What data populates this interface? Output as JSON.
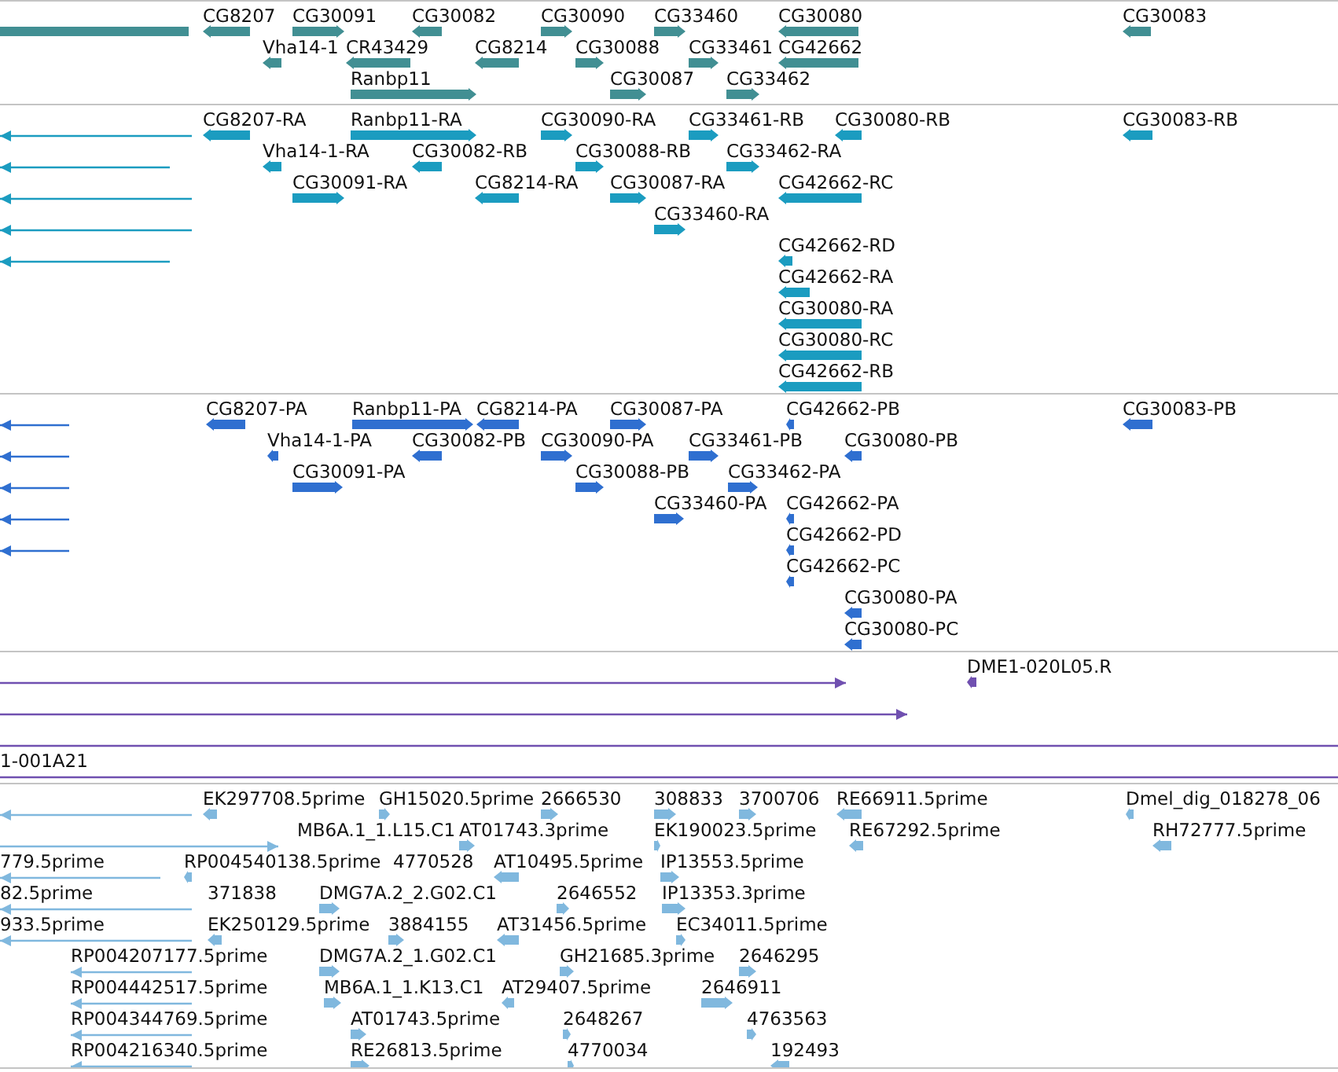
{
  "tracks": [
    {
      "kind": "gene",
      "color": "#418f93",
      "features": [
        {
          "kind": "cut"
        },
        {
          "label": "CG8207",
          "forward": false
        },
        {
          "label": "CG30091",
          "forward": true
        },
        {
          "label": "CG30082",
          "forward": false
        },
        {
          "label": "CG30090",
          "forward": true
        },
        {
          "label": "CG33460",
          "forward": true
        },
        {
          "label": "CG30080",
          "forward": false
        },
        {
          "label": "CG30083",
          "forward": false
        },
        {
          "label": "Vha14-1",
          "forward": false
        },
        {
          "label": "CR43429",
          "forward": false
        },
        {
          "label": "CG8214",
          "forward": false
        },
        {
          "label": "CG30088",
          "forward": true
        },
        {
          "label": "CG33461",
          "forward": true
        },
        {
          "label": "CG42662",
          "forward": false
        },
        {
          "label": "Ranbp11",
          "forward": true
        },
        {
          "label": "CG30087",
          "forward": true
        },
        {
          "label": "CG33462",
          "forward": true
        }
      ]
    },
    {
      "kind": "transcript",
      "color": "#1b9cc0",
      "features": [
        {
          "forward": false
        },
        {
          "label": "CG8207-RA",
          "forward": false
        },
        {
          "label": "Ranbp11-RA",
          "forward": true
        },
        {
          "label": "CG30090-RA",
          "forward": true
        },
        {
          "label": "CG33461-RB",
          "forward": true
        },
        {
          "label": "CG30080-RB",
          "forward": false
        },
        {
          "label": "CG30083-RB",
          "forward": false
        },
        {
          "forward": false
        },
        {
          "label": "Vha14-1-RA",
          "forward": false
        },
        {
          "label": "CG30082-RB",
          "forward": false
        },
        {
          "label": "CG30088-RB",
          "forward": true
        },
        {
          "label": "CG33462-RA",
          "forward": true
        },
        {
          "forward": false
        },
        {
          "label": "CG30091-RA",
          "forward": true
        },
        {
          "label": "CG8214-RA",
          "forward": false
        },
        {
          "label": "CG30087-RA",
          "forward": true
        },
        {
          "label": "CG42662-RC",
          "forward": false
        },
        {
          "forward": false
        },
        {
          "label": "CG33460-RA",
          "forward": true
        },
        {
          "forward": false
        },
        {
          "label": "CG42662-RD",
          "forward": false
        },
        {
          "label": "CG42662-RA",
          "forward": false
        },
        {
          "label": "CG30080-RA",
          "forward": false
        },
        {
          "label": "CG30080-RC",
          "forward": false
        },
        {
          "label": "CG42662-RB",
          "forward": false
        }
      ]
    },
    {
      "kind": "protein",
      "color": "#2f6fd0",
      "features": [
        {
          "forward": false
        },
        {
          "label": "CG8207-PA",
          "forward": false
        },
        {
          "label": "Ranbp11-PA",
          "forward": true
        },
        {
          "label": "CG8214-PA",
          "forward": false
        },
        {
          "label": "CG30087-PA",
          "forward": true
        },
        {
          "label": "CG42662-PB",
          "forward": false
        },
        {
          "label": "CG30083-PB",
          "forward": false
        },
        {
          "forward": false
        },
        {
          "label": "Vha14-1-PA",
          "forward": false
        },
        {
          "label": "CG30082-PB",
          "forward": false
        },
        {
          "label": "CG30090-PA",
          "forward": true
        },
        {
          "label": "CG33461-PB",
          "forward": true
        },
        {
          "label": "CG30080-PB",
          "forward": false
        },
        {
          "forward": false
        },
        {
          "label": "CG30091-PA",
          "forward": true
        },
        {
          "label": "CG30088-PB",
          "forward": true
        },
        {
          "label": "CG33462-PA",
          "forward": true
        },
        {
          "forward": false
        },
        {
          "label": "CG33460-PA",
          "forward": true
        },
        {
          "label": "CG42662-PA",
          "forward": false
        },
        {
          "forward": false
        },
        {
          "label": "CG42662-PD",
          "forward": false
        },
        {
          "label": "CG42662-PC",
          "forward": false
        },
        {
          "label": "CG30080-PA",
          "forward": false
        },
        {
          "label": "CG30080-PC",
          "forward": false
        }
      ]
    },
    {
      "kind": "clone",
      "color": "#7050b0",
      "features": [
        {
          "forward": true
        },
        {
          "label": "DME1-020L05.R",
          "forward": false
        },
        {
          "forward": true
        },
        {
          "kind": "cut"
        },
        {
          "label": "1-001A21"
        }
      ]
    },
    {
      "kind": "est",
      "color": "#80b8de",
      "features": [
        {
          "forward": false
        },
        {
          "label": "EK297708.5prime",
          "forward": false
        },
        {
          "label": "GH15020.5prime",
          "forward": true
        },
        {
          "label": "2666530",
          "forward": true
        },
        {
          "label": "308833",
          "forward": true
        },
        {
          "label": "3700706",
          "forward": true
        },
        {
          "label": "RE66911.5prime",
          "forward": false
        },
        {
          "label": "Dmel_dig_018278_06",
          "forward": false
        },
        {
          "forward": true
        },
        {
          "label": "MB6A.1_1.L15.C1"
        },
        {
          "label": "AT01743.3prime",
          "forward": true
        },
        {
          "label": "EK190023.5prime",
          "forward": true
        },
        {
          "label": "RE67292.5prime",
          "forward": false
        },
        {
          "label": "RH72777.5prime",
          "forward": false
        },
        {
          "label": "779.5prime",
          "forward": false
        },
        {
          "label": "RP004540138.5prime",
          "forward": false
        },
        {
          "label": "4770528"
        },
        {
          "label": "AT10495.5prime",
          "forward": false
        },
        {
          "label": "IP13553.5prime",
          "forward": true
        },
        {
          "label": "82.5prime",
          "forward": false
        },
        {
          "label": "371838"
        },
        {
          "label": "DMG7A.2_2.G02.C1",
          "forward": true
        },
        {
          "label": "2646552",
          "forward": true
        },
        {
          "label": "IP13353.3prime",
          "forward": true
        },
        {
          "label": "933.5prime",
          "forward": false
        },
        {
          "label": "EK250129.5prime",
          "forward": false
        },
        {
          "label": "3884155",
          "forward": true
        },
        {
          "label": "AT31456.5prime",
          "forward": false
        },
        {
          "label": "EC34011.5prime",
          "forward": true
        },
        {
          "label": "RP004207177.5prime",
          "forward": false
        },
        {
          "label": "DMG7A.2_1.G02.C1",
          "forward": true
        },
        {
          "label": "GH21685.3prime",
          "forward": true
        },
        {
          "label": "2646295",
          "forward": true
        },
        {
          "label": "RP004442517.5prime",
          "forward": false
        },
        {
          "label": "MB6A.1_1.K13.C1",
          "forward": true
        },
        {
          "label": "AT29407.5prime",
          "forward": false
        },
        {
          "label": "2646911",
          "forward": true
        },
        {
          "label": "RP004344769.5prime",
          "forward": false
        },
        {
          "label": "AT01743.5prime",
          "forward": true
        },
        {
          "label": "2648267",
          "forward": true
        },
        {
          "label": "4763563",
          "forward": true
        },
        {
          "label": "RP004216340.5prime",
          "forward": false
        },
        {
          "label": "RE26813.5prime",
          "forward": true
        },
        {
          "label": "4770034",
          "forward": true
        },
        {
          "label": "192493",
          "forward": false
        }
      ]
    }
  ]
}
